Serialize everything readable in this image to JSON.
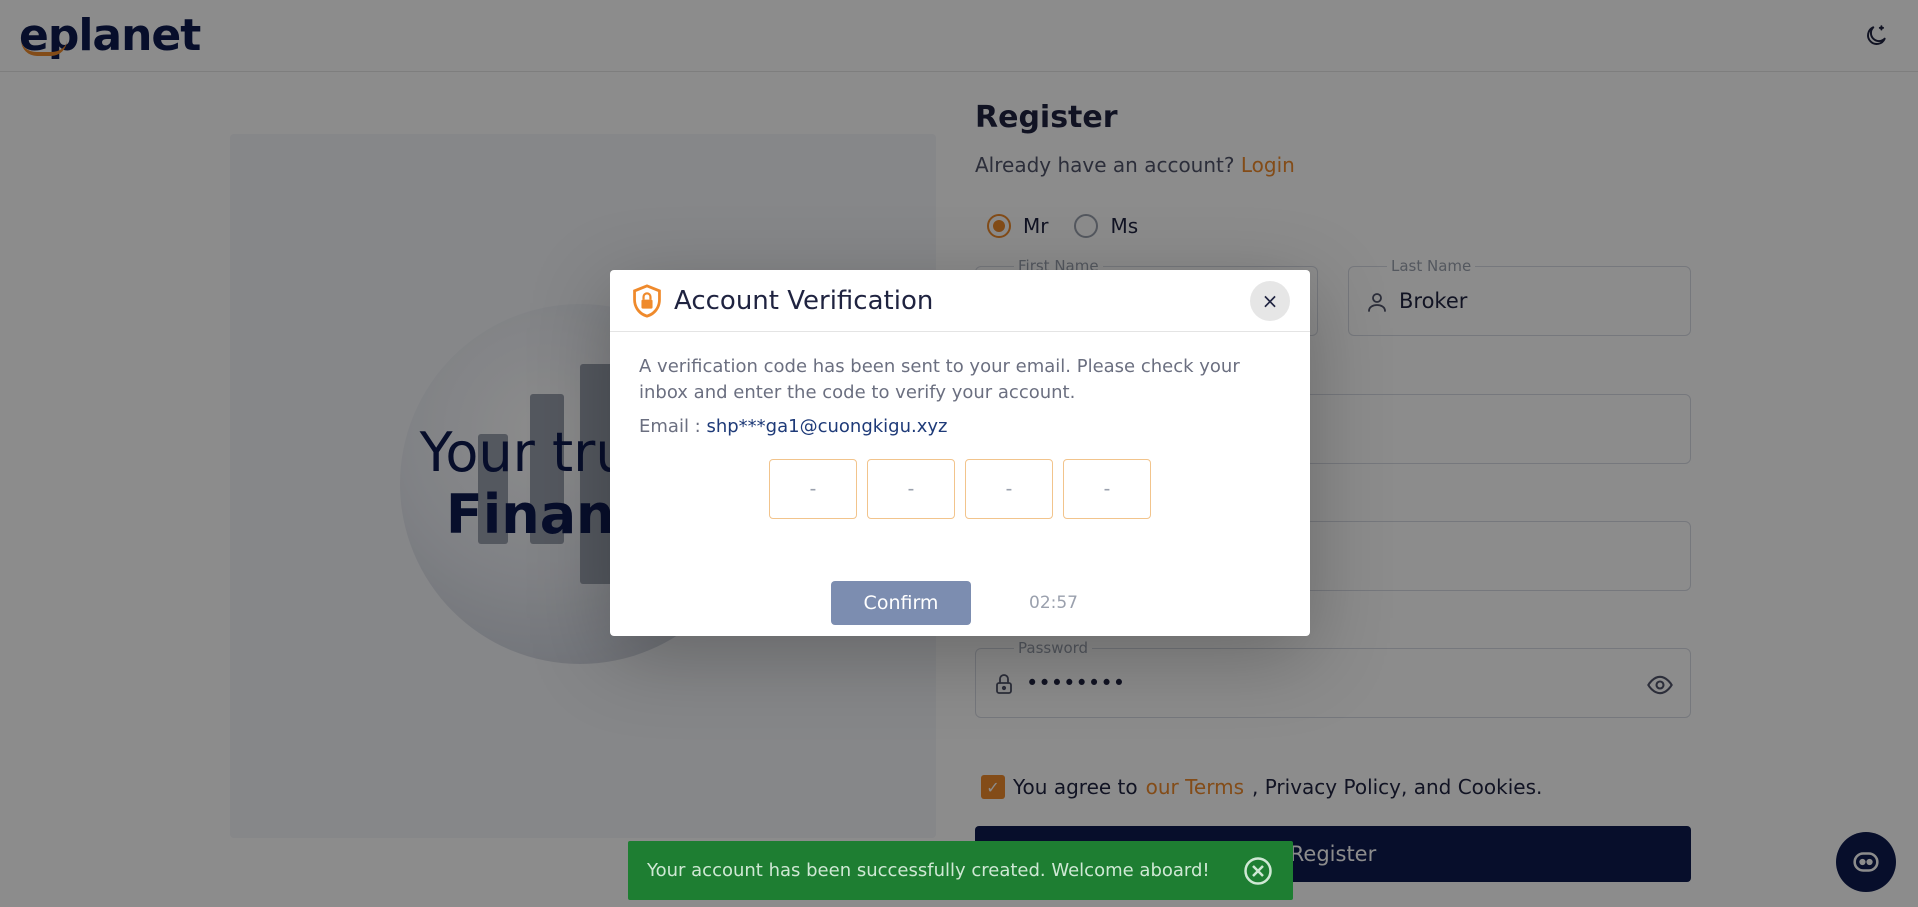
{
  "header": {
    "logo_text": "eplanet",
    "theme_icon": "moon-star-icon"
  },
  "hero": {
    "title_line1": "Your trusted",
    "title_line2": "Financial"
  },
  "form": {
    "title": "Register",
    "already_text": "Already have an account?",
    "login_link": "Login",
    "title_options": [
      {
        "label": "Mr",
        "selected": true
      },
      {
        "label": "Ms",
        "selected": false
      }
    ],
    "first_name_label": "First Name",
    "last_name_label": "Last Name",
    "last_name_value": "Broker",
    "password_label": "Password",
    "password_value": "••••••••",
    "agree_prefix": "You agree to",
    "agree_terms": "our Terms",
    "agree_suffix": ", Privacy Policy, and Cookies.",
    "register_label": "Register"
  },
  "modal": {
    "title": "Account Verification",
    "close_label": "×",
    "message": "A verification code has been sent to your email. Please check your inbox and enter the code to verify your account.",
    "email_label": "Email :",
    "email_value": "shp***ga1@cuongkigu.xyz",
    "otp_placeholder": "-",
    "confirm_label": "Confirm",
    "timer": "02:57"
  },
  "toast": {
    "message": "Your account has been successfully created. Welcome aboard!"
  },
  "colors": {
    "accent": "#ef8a2c",
    "brand": "#0d1b4f",
    "success": "#1e7e32"
  }
}
